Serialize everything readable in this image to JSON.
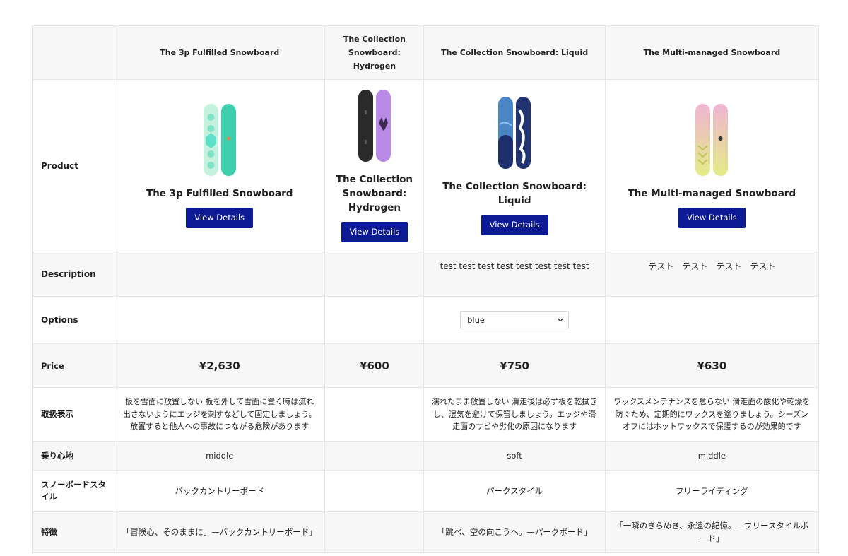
{
  "header": {
    "products": [
      "The 3p Fulfilled Snowboard",
      "The Collection Snowboard: Hydrogen",
      "The Collection Snowboard: Liquid",
      "The Multi-managed Snowboard"
    ]
  },
  "rows": {
    "product_label": "Product",
    "description_label": "Description",
    "options_label": "Options",
    "price_label": "Price",
    "care_label": "取扱表示",
    "ride_label": "乗り心地",
    "style_label": "スノーボードスタイル",
    "feature_label": "特徴"
  },
  "products": [
    {
      "title": "The 3p Fulfilled Snowboard",
      "button": "View Details",
      "board_icon": "snowboard-mint-icon",
      "colors": {
        "a": "#bdf0dc",
        "b": "#3ccfb0"
      },
      "description": "",
      "option": "",
      "price": "¥2,630",
      "care": "板を雪面に放置しない 板を外して雪面に置く時は流れ出さないようにエッジを刺すなどして固定しましょう。放置すると他人への事故につながる危険があります",
      "ride": "middle",
      "style": "バックカントリーボード",
      "feature": "「冒険心、そのままに。—バックカントリーボード」"
    },
    {
      "title": "The Collection Snowboard: Hydrogen",
      "button": "View Details",
      "board_icon": "snowboard-black-purple-icon",
      "colors": {
        "a": "#2b2b2b",
        "b": "#b78be8"
      },
      "description": "",
      "option": "",
      "price": "¥600",
      "care": "",
      "ride": "",
      "style": "",
      "feature": ""
    },
    {
      "title": "The Collection Snowboard: Liquid",
      "button": "View Details",
      "board_icon": "snowboard-blue-icon",
      "colors": {
        "a": "#3f7fbf",
        "b": "#1f2f6e"
      },
      "description": "test test test test test test test test",
      "option": "blue",
      "price": "¥750",
      "care": "濡れたまま放置しない 滑走後は必ず板を乾拭きし、湿気を避けて保管しましょう。エッジや滑走面のサビや劣化の原因になります",
      "ride": "soft",
      "style": "パークスタイル",
      "feature": "「跳べ、空の向こうへ。—パークボード」"
    },
    {
      "title": "The Multi-managed Snowboard",
      "button": "View Details",
      "board_icon": "snowboard-pastel-icon",
      "colors": {
        "a": "#f1b7d6",
        "b": "#e6ec8a"
      },
      "description": "テスト　テスト　テスト　テスト",
      "option": "",
      "price": "¥630",
      "care": "ワックスメンテナンスを怠らない 滑走面の酸化や乾燥を防ぐため、定期的にワックスを塗りましょう。シーズンオフにはホットワックスで保護するのが効果的です",
      "ride": "middle",
      "style": "フリーライディング",
      "feature": "「一瞬のきらめき、永遠の記憶。—フリースタイルボード」"
    }
  ],
  "accent": "#0d1a96"
}
